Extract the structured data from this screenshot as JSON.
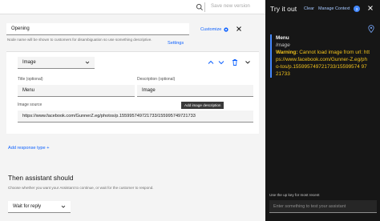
{
  "topbar": {
    "save_label": "Save new version"
  },
  "node_name": {
    "value": "Opening",
    "customize_label": "Customize",
    "hint": "Node name will be shown to customers for disambiguation so use something descriptive.",
    "settings_label": "Settings"
  },
  "response": {
    "type_value": "Image",
    "title_label": "Title (optional)",
    "title_value": "Menu",
    "description_label": "Description (optional)",
    "description_value": "Image",
    "source_label": "Image source",
    "source_value": "https://www.facebook.com/GunnerZ.eg/photos/p.155995749721733/155995749721733",
    "tooltip": "Add image description",
    "add_response_label": "Add response type +"
  },
  "then": {
    "title": "Then assistant should",
    "hint": "Choose whether you want your Assistant to continue, or wait for the customer to respond.",
    "select_value": "Wait for reply"
  },
  "try_panel": {
    "title": "Try it out",
    "clear_label": "Clear",
    "manage_context_label": "Manage Context",
    "context_count": "3",
    "message": {
      "heading": "Menu",
      "subheading": "Image",
      "warning_label": "Warning:",
      "warning_text": "Cannot load image from url: https://www.facebook.com/Gunner-Z.eg/pho-tos/p.155995749721733/15599574 9721733"
    },
    "hint": "Use the up key for most recent",
    "input_placeholder": "Enter something to test your assistant"
  }
}
